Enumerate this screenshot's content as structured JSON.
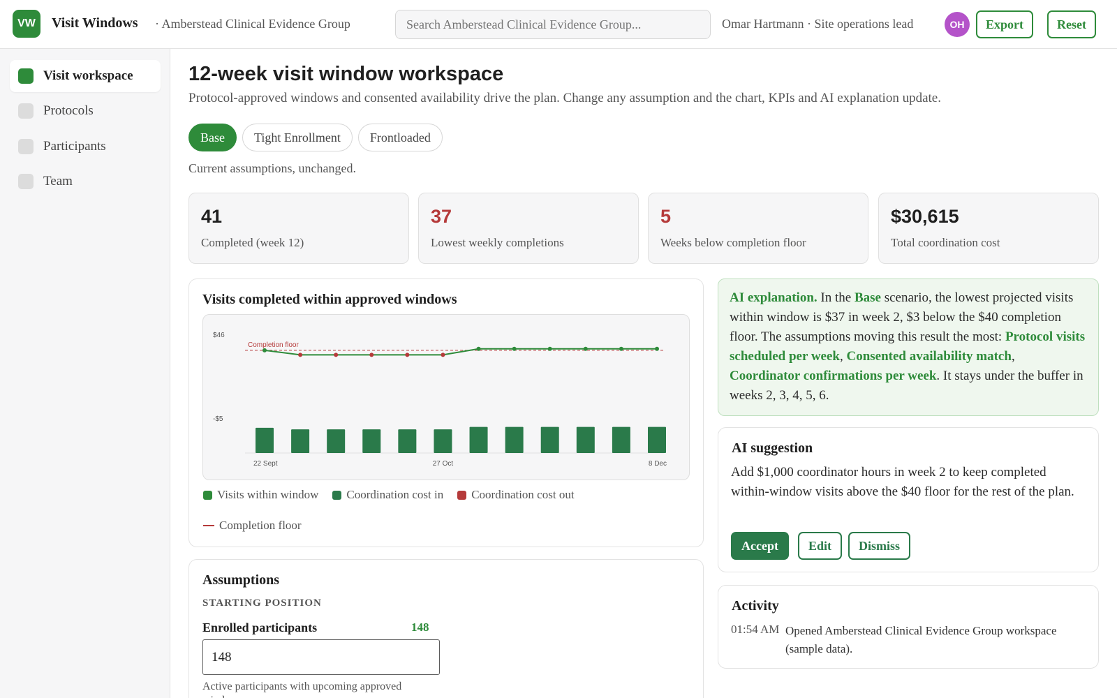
{
  "app": {
    "logo_initials": "VW",
    "title": "Visit Windows",
    "org": "· Amberstead Clinical Evidence Group"
  },
  "search": {
    "placeholder": "Search Amberstead Clinical Evidence Group..."
  },
  "user": {
    "label": "Omar Hartmann · Site operations lead",
    "initials": "OH"
  },
  "toolbar": {
    "export_label": "Export",
    "reset_label": "Reset"
  },
  "sidebar": {
    "items": [
      {
        "label": "Visit workspace",
        "active": true
      },
      {
        "label": "Protocols",
        "active": false
      },
      {
        "label": "Participants",
        "active": false
      },
      {
        "label": "Team",
        "active": false
      }
    ]
  },
  "page": {
    "title": "12-week visit window workspace",
    "subtitle": "Protocol-approved windows and consented availability drive the plan. Change any assumption and the chart, KPIs and AI explanation update.",
    "tabs": [
      {
        "label": "Base",
        "active": true
      },
      {
        "label": "Tight Enrollment",
        "active": false
      },
      {
        "label": "Frontloaded",
        "active": false
      }
    ],
    "scenario_note": "Current assumptions, unchanged."
  },
  "kpis": [
    {
      "value": "41",
      "label": "Completed (week 12)",
      "status": "normal"
    },
    {
      "value": "37",
      "label": "Lowest weekly completions",
      "status": "bad"
    },
    {
      "value": "5",
      "label": "Weeks below completion floor",
      "status": "bad"
    },
    {
      "value": "$30,615",
      "label": "Total coordination cost",
      "status": "normal"
    }
  ],
  "chart_card": {
    "title": "Visits completed within approved windows"
  },
  "chart_data": {
    "type": "line",
    "title": "Visits completed within approved windows",
    "x": [
      "22 Sept",
      "29 Sept",
      "6 Oct",
      "13 Oct",
      "20 Oct",
      "27 Oct",
      "3 Nov",
      "10 Nov",
      "17 Nov",
      "24 Nov",
      "1 Dec",
      "8 Dec"
    ],
    "x_tick_labels": [
      "22 Sept",
      "27 Oct",
      "8 Dec"
    ],
    "y_tick_labels": [
      "$46",
      "-$5"
    ],
    "ylim": [
      -5,
      46
    ],
    "series": [
      {
        "name": "Visits within window",
        "type": "line",
        "color": "#2e8b3a",
        "values": [
          40,
          37,
          37,
          37,
          37,
          37,
          41,
          41,
          41,
          41,
          41,
          41
        ]
      },
      {
        "name": "Coordination cost in",
        "type": "bar",
        "color": "#2a7a4a",
        "values": [
          null,
          null,
          null,
          null,
          null,
          null,
          null,
          null,
          null,
          null,
          null,
          null
        ]
      },
      {
        "name": "Coordination cost out",
        "type": "bar",
        "color": "#b53a3a",
        "values": [
          null,
          null,
          null,
          null,
          null,
          null,
          null,
          null,
          null,
          null,
          null,
          null
        ]
      }
    ],
    "completion_floor": {
      "name": "Completion floor",
      "value": 40,
      "color": "#b53a3a",
      "label": "Completion floor"
    },
    "below_floor_color": "#b53a3a",
    "legend": [
      {
        "label": "Visits within window",
        "kind": "box",
        "color": "#2e8b3a"
      },
      {
        "label": "Coordination cost in",
        "kind": "box",
        "color": "#2a7a4a"
      },
      {
        "label": "Coordination cost out",
        "kind": "box",
        "color": "#b53a3a"
      },
      {
        "label": "Completion floor",
        "kind": "line",
        "color": "#b53a3a"
      }
    ],
    "bar_relative_heights": [
      0.82,
      0.77,
      0.77,
      0.77,
      0.77,
      0.77,
      0.85,
      0.85,
      0.85,
      0.85,
      0.85,
      0.85
    ]
  },
  "explanation": {
    "lead": "AI explanation.",
    "t1": " In the ",
    "scenario": "Base",
    "t2": " scenario, the lowest projected visits within window is $37 in week 2, $3 below the $40 completion floor. The assumptions moving this result the most: ",
    "driver1": "Protocol visits scheduled per week",
    "sep1": ", ",
    "driver2": "Consented availability match",
    "sep2": ", ",
    "driver3": "Coordinator confirmations per week",
    "t3": ". It stays under the buffer in weeks 2, 3, 4, 5, 6."
  },
  "suggestion": {
    "title": "AI suggestion",
    "text": "Add $1,000 coordinator hours in week 2 to keep completed within-window visits above the $40 floor for the rest of the plan.",
    "accept_label": "Accept",
    "edit_label": "Edit",
    "dismiss_label": "Dismiss"
  },
  "activity": {
    "title": "Activity",
    "items": [
      {
        "time": "01:54 AM",
        "text": "Opened Amberstead Clinical Evidence Group workspace (sample data)."
      }
    ]
  },
  "assumptions": {
    "title": "Assumptions",
    "section": "STARTING POSITION",
    "field_label": "Enrolled participants",
    "field_value": "148",
    "input_value": "148",
    "help": "Active participants with upcoming approved windows."
  },
  "colors": {
    "accent": "#2e8b3a",
    "bad": "#b53a3a",
    "avatar": "#b453c9"
  }
}
